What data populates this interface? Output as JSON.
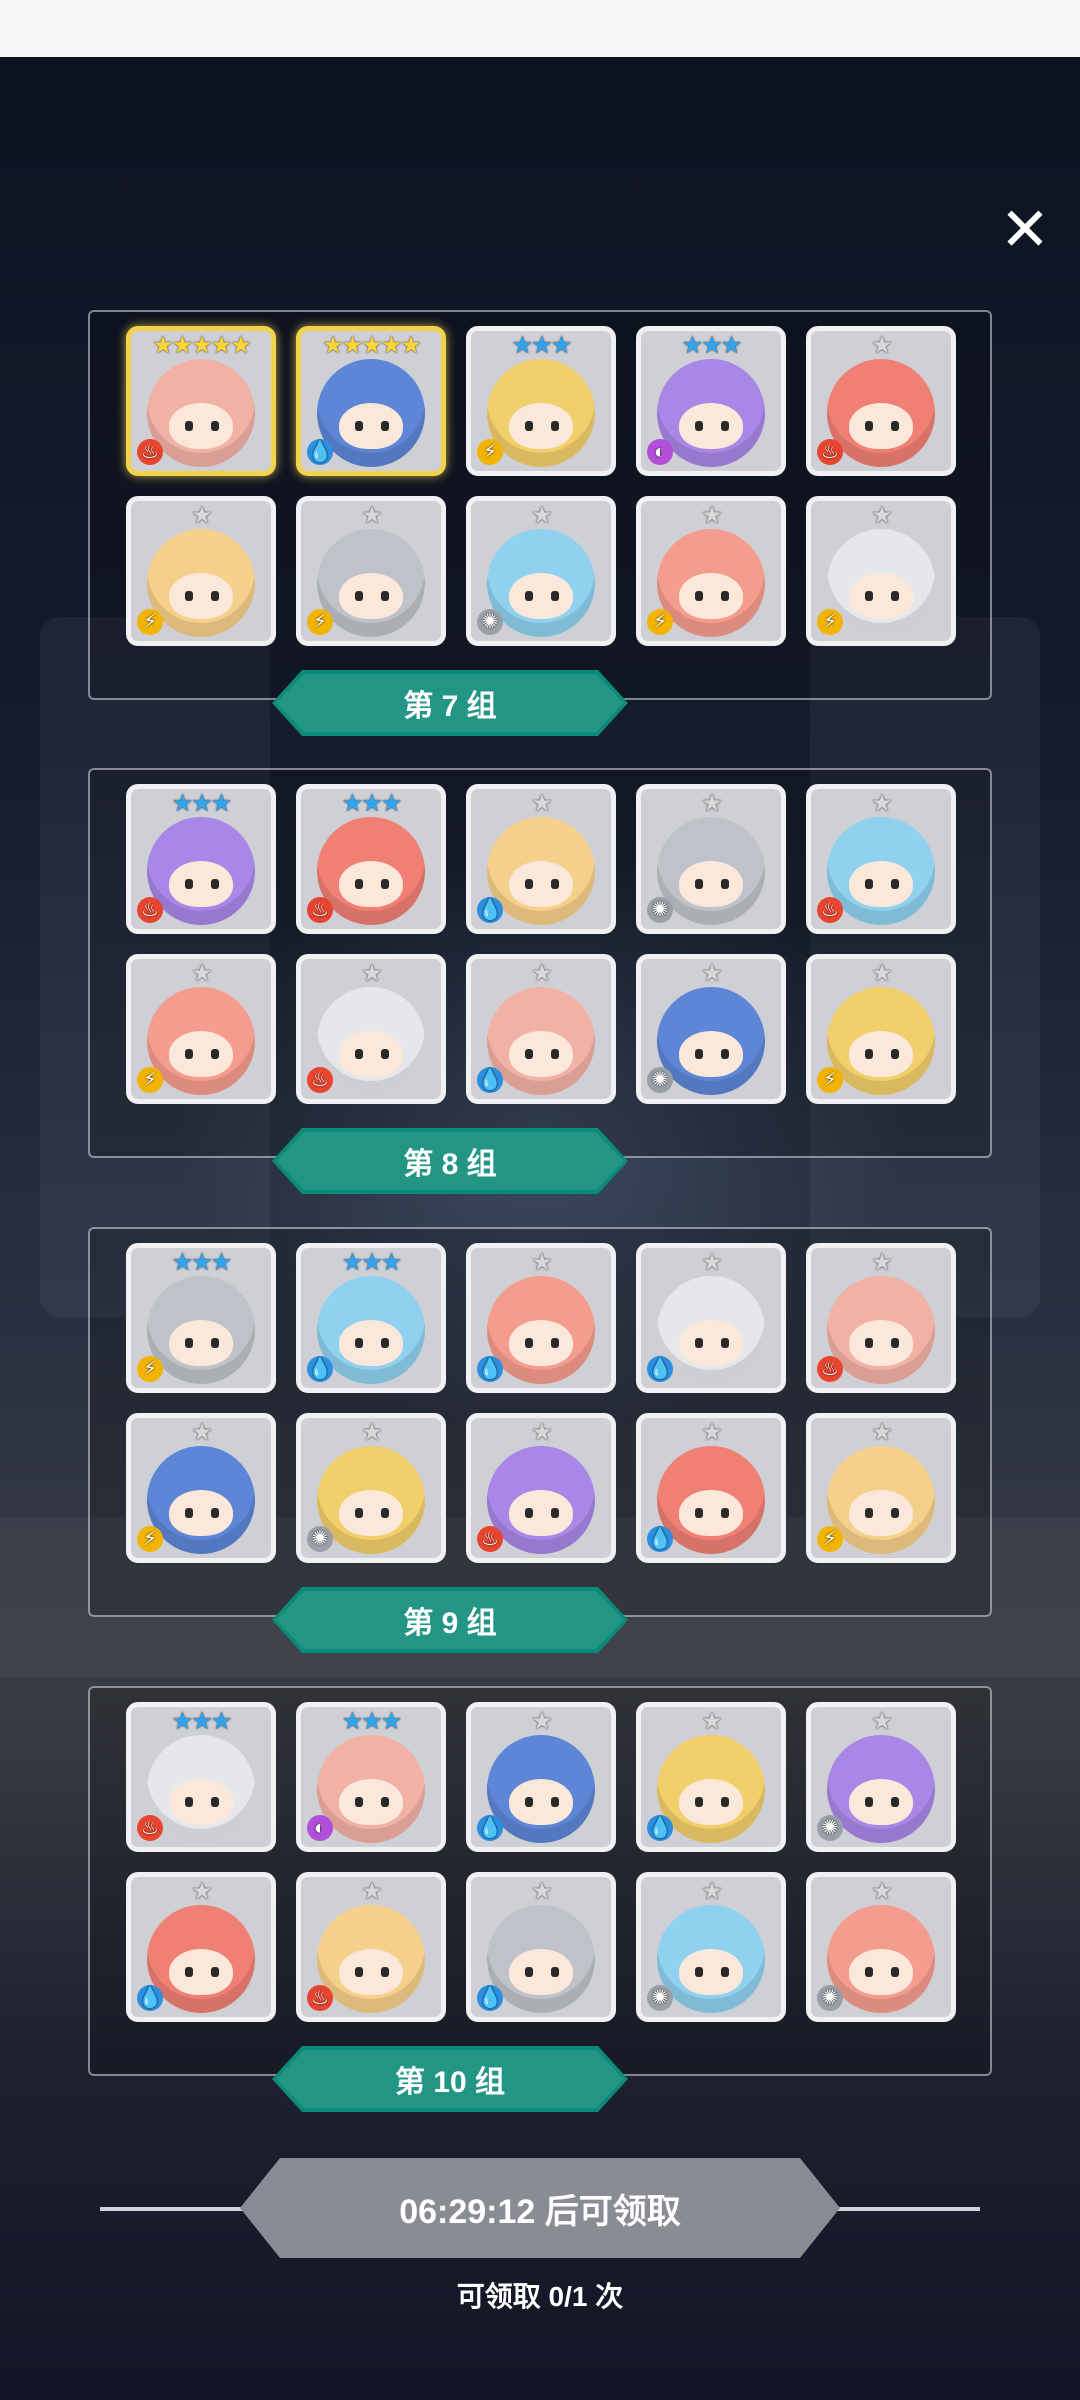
{
  "close_label": "✕",
  "groups": [
    {
      "title": "第 7 组",
      "cards": [
        {
          "stars": 5,
          "element": "fire"
        },
        {
          "stars": 5,
          "element": "water"
        },
        {
          "stars": 3,
          "element": "lightning"
        },
        {
          "stars": 3,
          "element": "dark"
        },
        {
          "stars": 1,
          "element": "fire"
        },
        {
          "stars": 1,
          "element": "lightning"
        },
        {
          "stars": 1,
          "element": "lightning"
        },
        {
          "stars": 1,
          "element": "light"
        },
        {
          "stars": 1,
          "element": "lightning"
        },
        {
          "stars": 1,
          "element": "lightning"
        }
      ]
    },
    {
      "title": "第 8 组",
      "cards": [
        {
          "stars": 3,
          "element": "fire"
        },
        {
          "stars": 3,
          "element": "fire"
        },
        {
          "stars": 1,
          "element": "water"
        },
        {
          "stars": 1,
          "element": "light"
        },
        {
          "stars": 1,
          "element": "fire"
        },
        {
          "stars": 1,
          "element": "lightning"
        },
        {
          "stars": 1,
          "element": "fire"
        },
        {
          "stars": 1,
          "element": "water"
        },
        {
          "stars": 1,
          "element": "light"
        },
        {
          "stars": 1,
          "element": "lightning"
        }
      ]
    },
    {
      "title": "第 9 组",
      "cards": [
        {
          "stars": 3,
          "element": "lightning"
        },
        {
          "stars": 3,
          "element": "water"
        },
        {
          "stars": 1,
          "element": "water"
        },
        {
          "stars": 1,
          "element": "water"
        },
        {
          "stars": 1,
          "element": "fire"
        },
        {
          "stars": 1,
          "element": "lightning"
        },
        {
          "stars": 1,
          "element": "light"
        },
        {
          "stars": 1,
          "element": "fire"
        },
        {
          "stars": 1,
          "element": "water"
        },
        {
          "stars": 1,
          "element": "lightning"
        }
      ]
    },
    {
      "title": "第 10 组",
      "cards": [
        {
          "stars": 3,
          "element": "fire"
        },
        {
          "stars": 3,
          "element": "dark"
        },
        {
          "stars": 1,
          "element": "water"
        },
        {
          "stars": 1,
          "element": "water"
        },
        {
          "stars": 1,
          "element": "light"
        },
        {
          "stars": 1,
          "element": "water"
        },
        {
          "stars": 1,
          "element": "fire"
        },
        {
          "stars": 1,
          "element": "water"
        },
        {
          "stars": 1,
          "element": "light"
        },
        {
          "stars": 1,
          "element": "light"
        }
      ]
    }
  ],
  "claim": {
    "button_label": "06:29:12 后可领取",
    "count_label": "可领取 0/1 次"
  },
  "colors": {
    "banner": "#0b8a78",
    "button_disabled": "#8a8c93",
    "star_5": "#ffd633",
    "star_3": "#2fa4f0",
    "star_1": "#d9d9d9",
    "fire": "#e8452e",
    "water": "#2c8fe0",
    "lightning": "#f2b400",
    "light": "#9aa0a8",
    "dark": "#b24fd8"
  },
  "portrait_palette": [
    "#f2b1a5",
    "#5d86d6",
    "#f1cf6a",
    "#a887e6",
    "#f07f74",
    "#f4d08a",
    "#bfc3c9",
    "#8fd1ef",
    "#f49c8e",
    "#e6e7ea"
  ]
}
